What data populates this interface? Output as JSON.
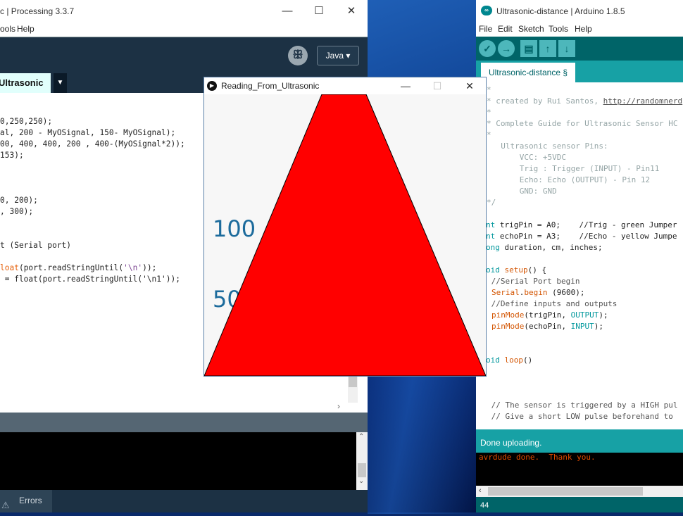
{
  "processing": {
    "title": "c | Processing 3.3.7",
    "menu": [
      "ools",
      "Help"
    ],
    "mode_icon": "butterfly-icon",
    "mode_label": "Java ▾",
    "tab_label": "Ultrasonic",
    "tab_menu_icon": "triangle-down-icon",
    "code_lines": [
      {
        "pre": "",
        "kw": "",
        "rest": "0,250,250);"
      },
      {
        "pre": "",
        "kw": "",
        "rest": "al, 200 - MyOSignal, 150- MyOSignal);"
      },
      {
        "pre": "",
        "kw": "",
        "rest": "00, 400, 400, 200 , 400-(MyOSignal*2));"
      },
      {
        "pre": "",
        "kw": "",
        "rest": "153);"
      },
      {
        "pre": "",
        "kw": "",
        "rest": "0, 200);"
      },
      {
        "pre": "",
        "kw": "",
        "rest": ", 300);"
      },
      {
        "pre": "",
        "kw": "",
        "rest": "t (Serial port)"
      },
      {
        "pre": "",
        "kw": "loat",
        "rest": "(port.readStringUntil(",
        "str": "'\\n'",
        "tail": "));"
      },
      {
        "pre": "",
        "kw": "",
        "rest": " = float(port.readStringUntil('\\n1'));"
      }
    ],
    "footer_tab": "Errors"
  },
  "sketch": {
    "title": "Reading_From_Ultrasonic",
    "label_100": "100",
    "label_50": "50",
    "fill_color": "#ff0000"
  },
  "arduino": {
    "title": "Ultrasonic-distance | Arduino 1.8.5",
    "menu": [
      "File",
      "Edit",
      "Sketch",
      "Tools",
      "Help"
    ],
    "tab_label": "Ultrasonic-distance §",
    "code": {
      "l1": "*",
      "l2a": "* created by Rui Santos, ",
      "l2b": "http://randomnerd",
      "l3": "*",
      "l4": "* Complete Guide for Ultrasonic Sensor HC",
      "l5": "*",
      "l6": "  Ultrasonic sensor Pins:",
      "l7": "      VCC: +5VDC",
      "l8": "      Trig : Trigger (INPUT) - Pin11",
      "l9": "      Echo: Echo (OUTPUT) - Pin 12",
      "l10": "      GND: GND",
      "l11": "*/",
      "l12a": "nt",
      "l12b": " trigPin = A0;    //Trig - green Jumper",
      "l13a": "nt",
      "l13b": " echoPin = A3;    //Echo - yellow Jumpe",
      "l14a": "ong",
      "l14b": " duration, cm, inches;",
      "l15a": "oid",
      "l15b": "setup",
      "l15c": "() {",
      "l16": " //Serial Port begin",
      "l17a": "Serial",
      "l17b": ".",
      "l17c": "begin",
      "l17d": " (9600);",
      "l18": " //Define inputs and outputs",
      "l19a": "pinMode",
      "l19b": "(trigPin, ",
      "l19c": "OUTPUT",
      "l19d": ");",
      "l20a": "pinMode",
      "l20b": "(echoPin, ",
      "l20c": "INPUT",
      "l20d": ");",
      "l21a": "oid",
      "l21b": "loop",
      "l21c": "()",
      "l22": " // The sensor is triggered by a HIGH pul",
      "l23": " // Give a short LOW pulse beforehand to"
    },
    "status": "Done uploading.",
    "console": "avrdude done.  Thank you.",
    "line_number": "44"
  }
}
